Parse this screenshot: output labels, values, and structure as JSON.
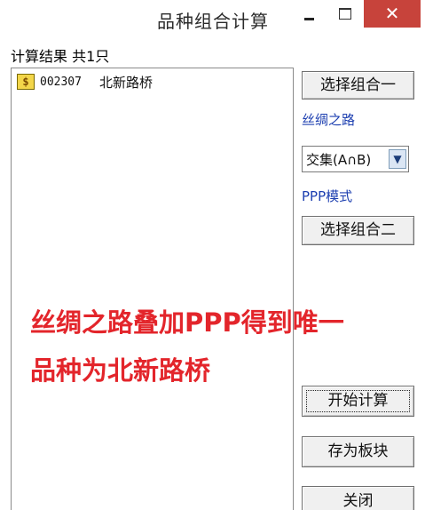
{
  "window": {
    "title": "品种组合计算",
    "minimize_glyph": "",
    "close_glyph": "✕"
  },
  "results": {
    "header": "计算结果 共1只",
    "items": [
      {
        "icon": "$",
        "code": "002307",
        "name": "北新路桥"
      }
    ]
  },
  "controls": {
    "select_combo_one": "选择组合一",
    "combo_one_name": "丝绸之路",
    "operation_value": "交集(A∩B)",
    "combo_two_name": "PPP模式",
    "select_combo_two": "选择组合二",
    "start_calc": "开始计算",
    "save_as_block": "存为板块",
    "close": "关闭"
  },
  "overlay": {
    "line1": "丝绸之路叠加PPP得到唯一",
    "line2": "品种为北新路桥"
  },
  "colors": {
    "close_button": "#c7433b",
    "link_blue": "#1d3fb0",
    "overlay_red": "#e3252b",
    "button_face": "#f0f0f0"
  }
}
